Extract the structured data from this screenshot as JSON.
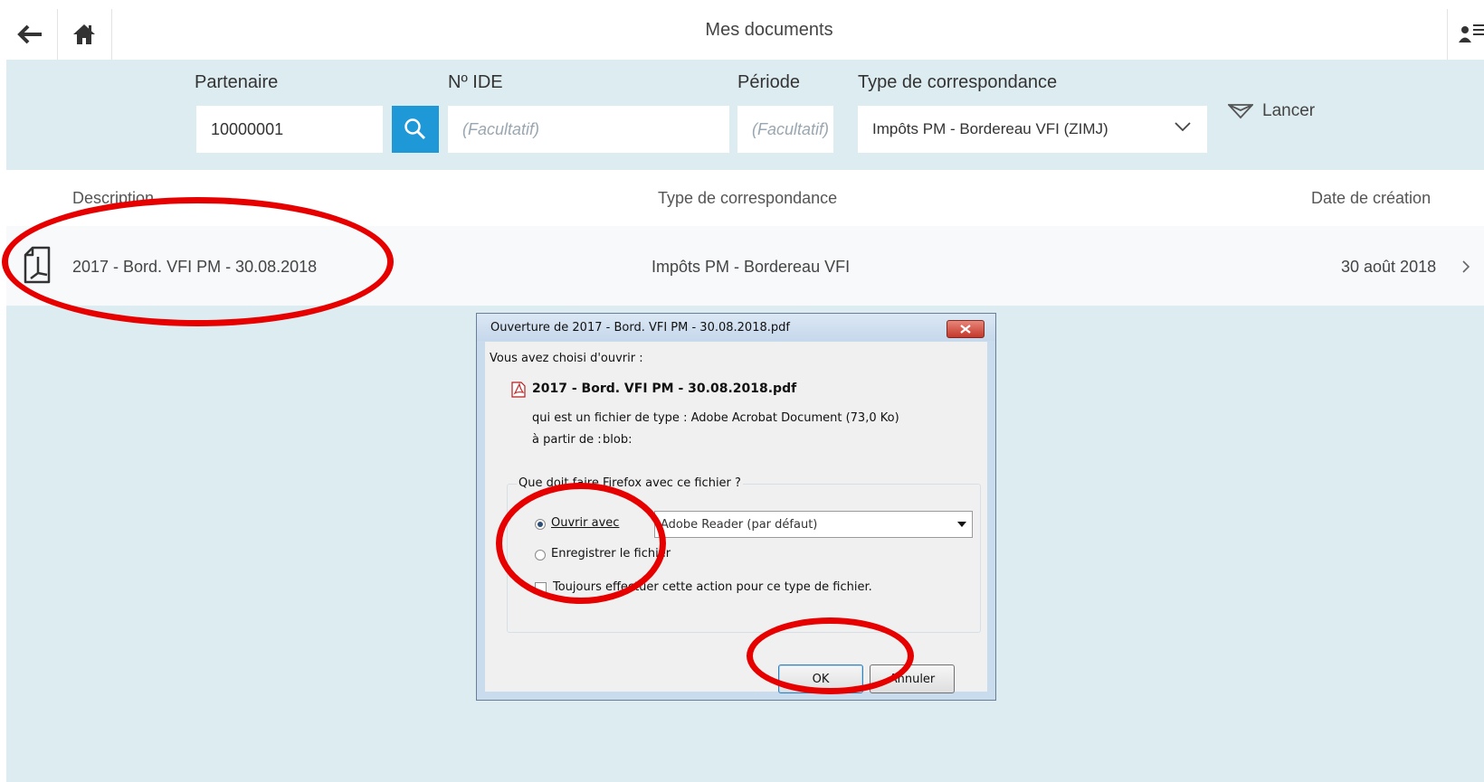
{
  "header": {
    "title": "Mes documents",
    "back_icon": "arrow-left-icon",
    "home_icon": "home-icon",
    "user_icon": "user-menu-icon"
  },
  "filters": {
    "partenaire_label": "Partenaire",
    "partenaire_value": "10000001",
    "ide_label": "Nº IDE",
    "ide_placeholder": "(Facultatif)",
    "periode_label": "Période",
    "periode_placeholder": "(Facultatif)",
    "type_label": "Type de correspondance",
    "type_value": "Impôts PM - Bordereau VFI (ZIMJ)",
    "launch_label": "Lancer"
  },
  "table": {
    "headers": [
      "Description",
      "Type de correspondance",
      "Date de création"
    ],
    "rows": [
      {
        "description": "2017 - Bord. VFI PM - 30.08.2018",
        "type": "Impôts PM - Bordereau VFI",
        "date": "30 août 2018"
      }
    ]
  },
  "dialog": {
    "title": "Ouverture de 2017 - Bord. VFI PM - 30.08.2018.pdf",
    "intro": "Vous avez choisi d'ouvrir :",
    "filename": "2017 - Bord. VFI PM - 30.08.2018.pdf",
    "type_line": "qui est un fichier de type : Adobe Acrobat Document (73,0 Ko)",
    "from_label": "à partir de :",
    "from_value": "blob:",
    "question": "Que doit faire Firefox avec ce fichier ?",
    "open_with_label": "Ouvrir avec",
    "open_with_app": "Adobe Reader (par défaut)",
    "save_label": "Enregistrer le fichier",
    "always_label": "Toujours effectuer cette action pour ce type de fichier.",
    "ok_label": "OK",
    "cancel_label": "Annuler",
    "open_with_selected": true,
    "always_checked": false
  },
  "colors": {
    "accent": "#1f98d7",
    "panel": "#ddecf0",
    "annotation": "#e60000"
  }
}
